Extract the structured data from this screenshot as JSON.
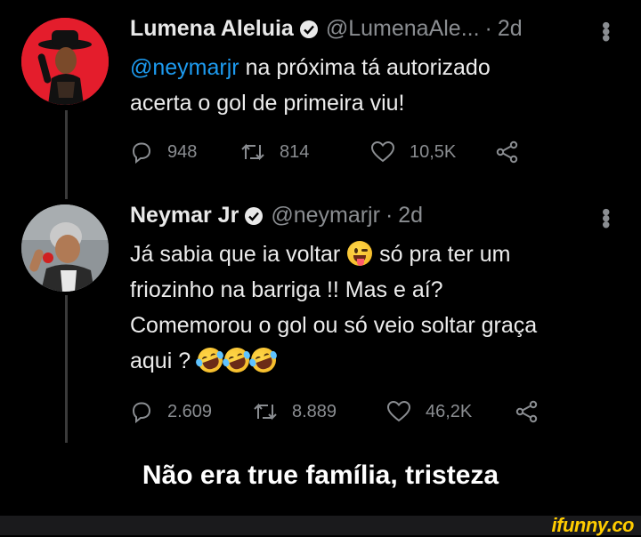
{
  "tweets": [
    {
      "name": "Lumena Aleluia",
      "handle": "@LumenaAle...",
      "separator": "·",
      "time": "2d",
      "mention": "@neymarjr",
      "line1_rest": " na próxima tá autorizado",
      "line2": "acerta o gol de primeira viu!",
      "replies": "948",
      "retweets": "814",
      "likes": "10,5K"
    },
    {
      "name": "Neymar Jr",
      "handle": "@neymarjr",
      "separator": "·",
      "time": "2d",
      "line1_pre": "Já sabia que ia voltar ",
      "line1_post": " só pra ter um",
      "line2": "friozinho na barriga !! Mas e aí?",
      "line3": "Comemorou o gol ou só veio soltar graça",
      "line4": "aqui ? ",
      "replies": "2.609",
      "retweets": "8.889",
      "likes": "46,2K"
    }
  ],
  "caption": "Não era true família, tristeza",
  "watermark": "ifunny.co",
  "colors": {
    "link": "#1d9bf0",
    "muted": "#8a8d91",
    "background": "#000000"
  }
}
